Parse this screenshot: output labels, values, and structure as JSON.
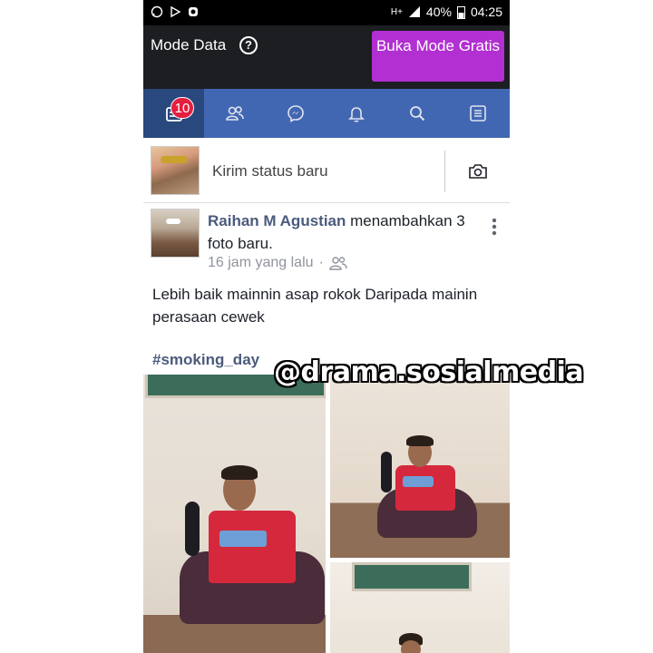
{
  "status_bar": {
    "network": "H+",
    "battery": "40%",
    "time": "04:25"
  },
  "data_bar": {
    "mode_label": "Mode Data",
    "help_icon": "question-circle-icon",
    "free_mode_button": "Buka Mode Gratis",
    "button_color": "#b22fd1"
  },
  "nav": {
    "brand_color": "#4267b2",
    "items": [
      {
        "name": "news-feed",
        "icon": "news-feed-icon"
      },
      {
        "name": "friends",
        "icon": "friends-icon"
      },
      {
        "name": "messenger",
        "icon": "messenger-icon"
      },
      {
        "name": "notifications",
        "icon": "bell-icon"
      },
      {
        "name": "search",
        "icon": "search-icon"
      },
      {
        "name": "menu",
        "icon": "menu-icon"
      }
    ],
    "news_badge": "10"
  },
  "composer": {
    "placeholder": "Kirim status baru",
    "camera_icon": "camera-icon"
  },
  "post": {
    "author": "Raihan M Agustian",
    "action": " menambahkan 3 foto baru.",
    "time": "16 jam yang lalu",
    "separator": "·",
    "audience_icon": "friends-icon",
    "text": "Lebih baik mainnin asap rokok Daripada mainin perasaan cewek",
    "hashtag": "#smoking_day"
  },
  "watermark": "@drama.sosialmedia"
}
